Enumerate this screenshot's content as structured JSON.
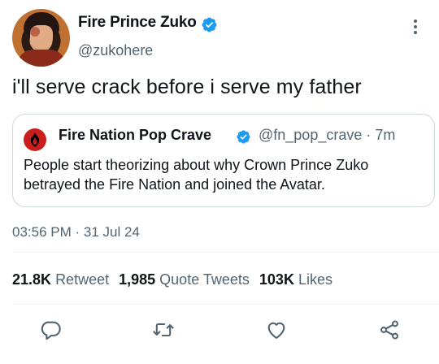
{
  "author": {
    "display_name": "Fire Prince Zuko",
    "handle": "@zukohere"
  },
  "tweet": {
    "text": "i'll serve crack before i serve my father"
  },
  "quoted_tweet": {
    "display_name": "Fire Nation Pop Crave",
    "handle_and_time": "@fn_pop_crave · 7m",
    "text": "People start theorizing about why Crown Prince Zuko betrayed the Fire Nation and joined the Avatar."
  },
  "meta": {
    "timestamp": "03:56 PM · 31 Jul 24"
  },
  "stats": {
    "retweets": "21.8K",
    "retweets_label": "Retweet",
    "quotes": "1,985",
    "quotes_label": "Quote Tweets",
    "likes": "103K",
    "likes_label": "Likes"
  },
  "icons": {
    "verified": "verified-badge-icon",
    "more": "more-vertical-icon",
    "reply": "reply-icon",
    "retweet": "retweet-icon",
    "like": "heart-icon",
    "share": "share-icon"
  },
  "colors": {
    "verified_blue": "#1d9bf0",
    "secondary_text": "#536471",
    "fire_nation_red": "#c81e1e"
  }
}
